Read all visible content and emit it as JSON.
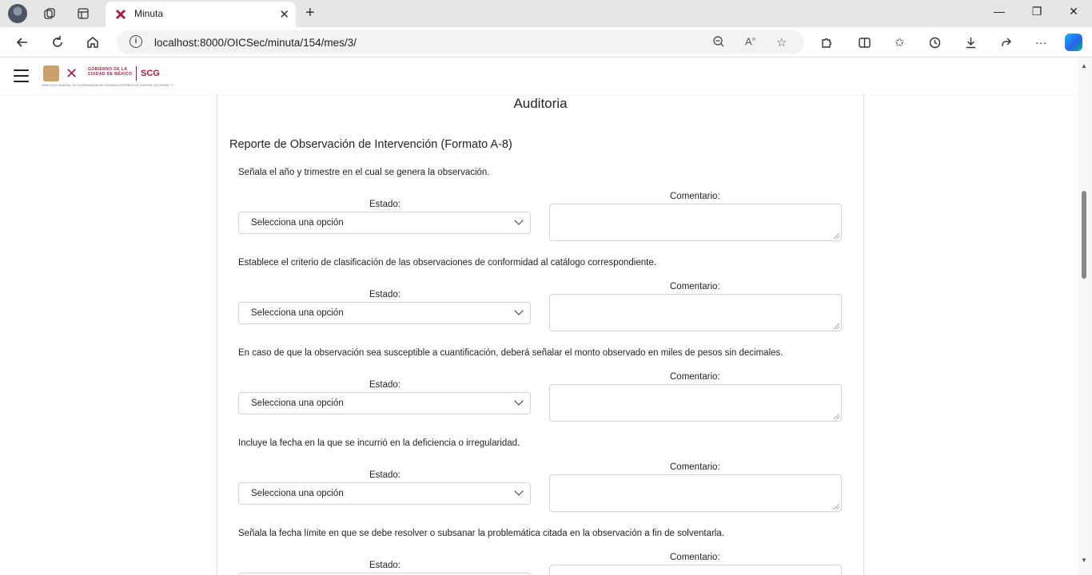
{
  "browser": {
    "tab_title": "Minuta",
    "url": "localhost:8000/OICSec/minuta/154/mes/3/",
    "icons": [
      "profile-avatar",
      "workspaces-icon",
      "tab-actions-icon",
      "back-icon",
      "refresh-icon",
      "home-icon",
      "zoom-icon",
      "read-aloud-icon",
      "favorite-star-icon",
      "extensions-icon",
      "split-screen-icon",
      "favorites-icon",
      "history-icon",
      "downloads-icon",
      "share-icon",
      "more-icon",
      "copilot-icon"
    ]
  },
  "header": {
    "logo_gov_line1": "GOBIERNO DE LA",
    "logo_gov_line2": "CIUDAD DE MÉXICO",
    "logo_scg": "SCG",
    "logo_subline": "DIRECCIÓN GENERAL DE COORDINACIÓN DE ÓRGANOS INTERNOS DE CONTROL SECTORIAL \"C\""
  },
  "card": {
    "title": "Auditoria",
    "section_title": "Reporte de Observación de Intervención (Formato A-8)",
    "estado_label": "Estado:",
    "comentario_label": "Comentario:",
    "select_placeholder": "Selecciona una opción",
    "questions": [
      {
        "text": "Señala el año y trimestre en el cual se genera la observación."
      },
      {
        "text": "Establece el criterio de clasificación de las observaciones de conformidad al catálogo correspondiente."
      },
      {
        "text": "En caso de que la observación sea susceptible a cuantificación, deberá señalar el monto observado en miles de pesos sin decimales."
      },
      {
        "text": "Incluye la fecha en la que se incurrió en la deficiencia o irregularidad."
      },
      {
        "text": "Señala la fecha límite en que se debe resolver o subsanar la problemática citada en la observación a fin de solventarla."
      }
    ]
  }
}
